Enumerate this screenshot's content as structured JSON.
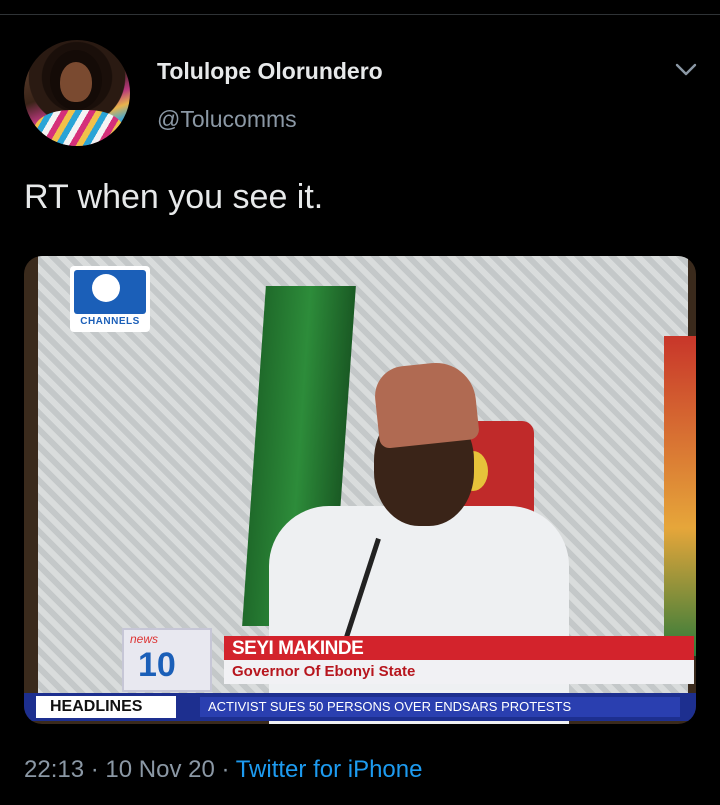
{
  "tweet": {
    "author_name": "Tolulope Olorundero",
    "author_handle": "@Tolucomms",
    "text": "RT when you see it.",
    "time": "22:13",
    "date": "10 Nov 20",
    "separator": "·",
    "source": "Twitter for iPhone"
  },
  "media": {
    "channel_logo_text": "CHANNELS",
    "news_badge_top": "news",
    "news_badge_number": "10",
    "lower_third_name": "SEYI MAKINDE",
    "lower_third_title": "Governor Of Ebonyi State",
    "ticker_label": "HEADLINES",
    "ticker_text": "ACTIVIST SUES 50 PERSONS OVER ENDSARS PROTESTS"
  },
  "colors": {
    "background": "#000000",
    "text_primary": "#e7e9ea",
    "text_secondary": "#8b98a5",
    "link": "#1d9bf0"
  },
  "icons": {
    "menu": "chevron-down-icon"
  }
}
